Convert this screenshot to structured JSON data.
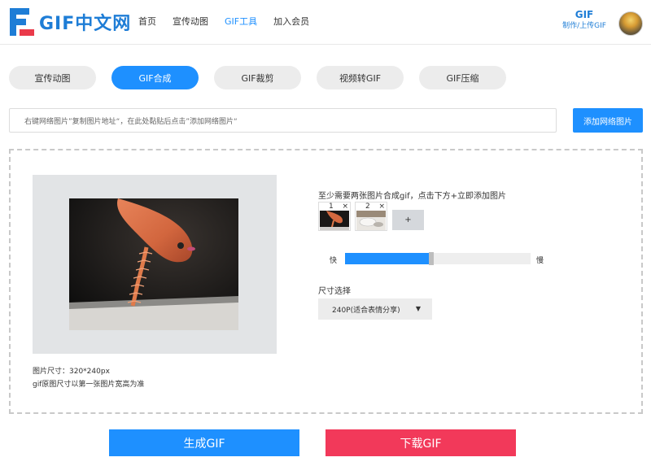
{
  "header": {
    "logo_text": "GIF中文网",
    "nav": [
      "首页",
      "宣传动图",
      "GIF工具",
      "加入会员"
    ],
    "active_nav_index": 2,
    "right_title": "GIF",
    "right_subtitle": "制作/上传GIF"
  },
  "tabs": [
    "宣传动图",
    "GIF合成",
    "GIF裁剪",
    "视频转GIF",
    "GIF压缩"
  ],
  "active_tab_index": 1,
  "url_input": {
    "placeholder": "右键网络图片”复制图片地址“，在此处黏贴后点击”添加网络图片“"
  },
  "add_button_label": "添加网络图片",
  "preview": {
    "size_text": "图片尺寸：320*240px",
    "note_text": "gif原图尺寸以第一张图片宽高为准"
  },
  "frames": {
    "hint": "至少需要两张图片合成gif，点击下方+立即添加图片",
    "items": [
      {
        "index": "1",
        "remove": "×"
      },
      {
        "index": "2",
        "remove": "×"
      }
    ],
    "add_label": "+"
  },
  "speed": {
    "fast_label": "快",
    "slow_label": "慢",
    "value_fraction": 0.45
  },
  "size_select": {
    "label": "尺寸选择",
    "selected": "240P(适合表情分享)"
  },
  "buttons": {
    "generate": "生成GIF",
    "download": "下载GIF"
  },
  "colors": {
    "accent": "#1e90ff",
    "download": "#f2395a",
    "logo_blue": "#1e7dd6",
    "logo_red": "#ea3a4a"
  }
}
